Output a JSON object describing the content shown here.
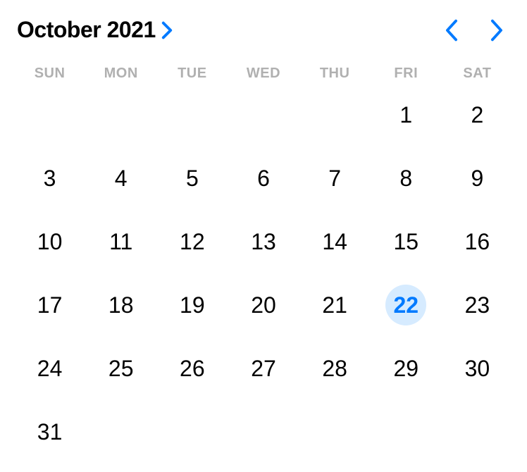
{
  "header": {
    "month_label": "October 2021"
  },
  "weekdays": [
    "SUN",
    "MON",
    "TUE",
    "WED",
    "THU",
    "FRI",
    "SAT"
  ],
  "days": {
    "leading_blanks": 5,
    "count": 31,
    "selected": 22
  },
  "colors": {
    "accent": "#007aff",
    "selected_bg": "#d6ebff",
    "weekday": "#b0b0b0"
  }
}
